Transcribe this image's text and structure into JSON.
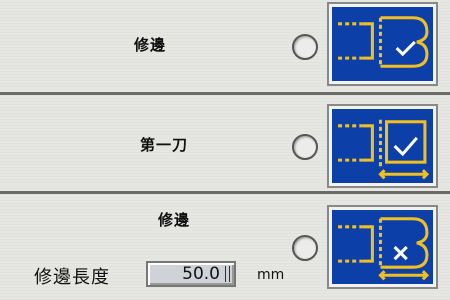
{
  "rows": [
    {
      "label": "修邊"
    },
    {
      "label": "第一刀"
    },
    {
      "label": "修邊"
    }
  ],
  "trim_length": {
    "label": "修邊長度",
    "value": "50.0",
    "unit": "mm"
  },
  "colors": {
    "icon_bg": "#0d3fa8",
    "icon_fg": "#f0c020",
    "accent_white": "#ffffff"
  },
  "icons": [
    "trim-check-icon",
    "first-cut-check-icon",
    "trim-cross-icon"
  ]
}
